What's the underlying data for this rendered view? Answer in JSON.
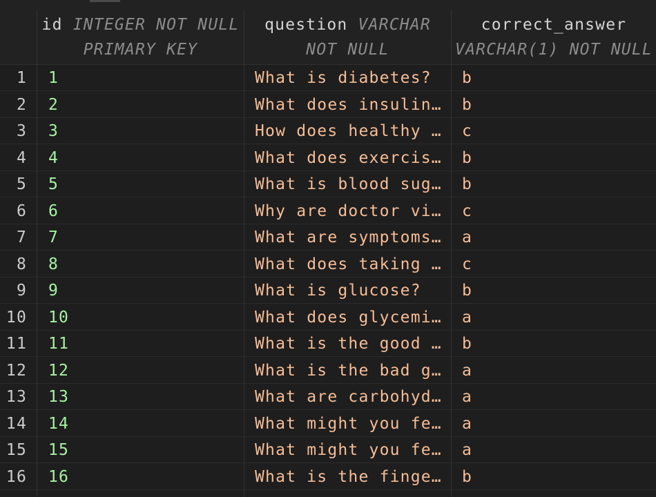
{
  "columns": [
    {
      "name": "id",
      "type_line1": "INTEGER NOT NULL",
      "type_line2": "PRIMARY KEY"
    },
    {
      "name": "question",
      "type_line1": "VARCHAR",
      "type_line2": "NOT NULL"
    },
    {
      "name": "correct_answer",
      "type_line1": "",
      "type_line2": "VARCHAR(1) NOT NULL"
    }
  ],
  "rows": [
    {
      "num": "1",
      "id": "1",
      "question": "What is diabetes?",
      "answer": "b"
    },
    {
      "num": "2",
      "id": "2",
      "question": "What does insulin…",
      "answer": "b"
    },
    {
      "num": "3",
      "id": "3",
      "question": "How does healthy …",
      "answer": "c"
    },
    {
      "num": "4",
      "id": "4",
      "question": "What does exercis…",
      "answer": "b"
    },
    {
      "num": "5",
      "id": "5",
      "question": "What is blood sug…",
      "answer": "b"
    },
    {
      "num": "6",
      "id": "6",
      "question": "Why are doctor vi…",
      "answer": "c"
    },
    {
      "num": "7",
      "id": "7",
      "question": "What are symptoms…",
      "answer": "a"
    },
    {
      "num": "8",
      "id": "8",
      "question": "What does taking …",
      "answer": "c"
    },
    {
      "num": "9",
      "id": "9",
      "question": "What is glucose?",
      "answer": "b"
    },
    {
      "num": "10",
      "id": "10",
      "question": "What does glycemi…",
      "answer": "a"
    },
    {
      "num": "11",
      "id": "11",
      "question": "What is the good …",
      "answer": "b"
    },
    {
      "num": "12",
      "id": "12",
      "question": "What is the bad g…",
      "answer": "a"
    },
    {
      "num": "13",
      "id": "13",
      "question": "What are carbohyd…",
      "answer": "a"
    },
    {
      "num": "14",
      "id": "14",
      "question": "What might you fe…",
      "answer": "a"
    },
    {
      "num": "15",
      "id": "15",
      "question": "What might you fe…",
      "answer": "a"
    },
    {
      "num": "16",
      "id": "16",
      "question": "What is the finge…",
      "answer": "b"
    }
  ],
  "colors": {
    "background": "#1e1e1e",
    "id_text": "#a7f3a3",
    "string_text": "#f6bd96",
    "type_text": "#8c8c8c"
  }
}
